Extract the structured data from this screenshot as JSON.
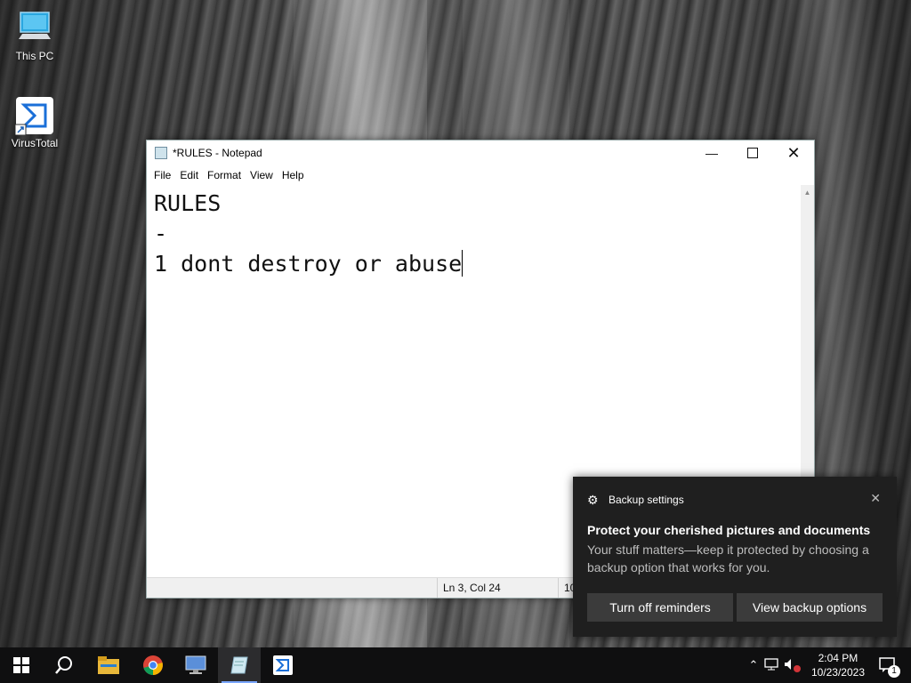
{
  "desktop": {
    "icons": [
      {
        "label": "This PC",
        "icon": "this-pc-icon"
      },
      {
        "label": "VirusTotal",
        "icon": "virustotal-icon"
      }
    ]
  },
  "notepad": {
    "title": "*RULES - Notepad",
    "menu": [
      "File",
      "Edit",
      "Format",
      "View",
      "Help"
    ],
    "content_lines": [
      "RULES",
      "-",
      "1 dont destroy or abuse"
    ],
    "status": {
      "position": "Ln 3, Col 24",
      "zoom_partial": "10"
    }
  },
  "toast": {
    "app": "Backup settings",
    "heading": "Protect your cherished pictures and documents",
    "body": "Your stuff matters—keep it protected by choosing a backup option that works for you.",
    "buttons": [
      "Turn off reminders",
      "View backup options"
    ]
  },
  "taskbar": {
    "apps": [
      "start-icon",
      "search-icon",
      "file-explorer-icon",
      "chrome-icon",
      "remote-desktop-icon",
      "notepad-icon",
      "virustotal-icon"
    ],
    "time": "2:04 PM",
    "date": "10/23/2023",
    "notification_count": "1"
  },
  "colors": {
    "accent": "#7aa6ff",
    "toast_bg": "#1f1f1f",
    "taskbar_bg": "#0f0f10"
  }
}
